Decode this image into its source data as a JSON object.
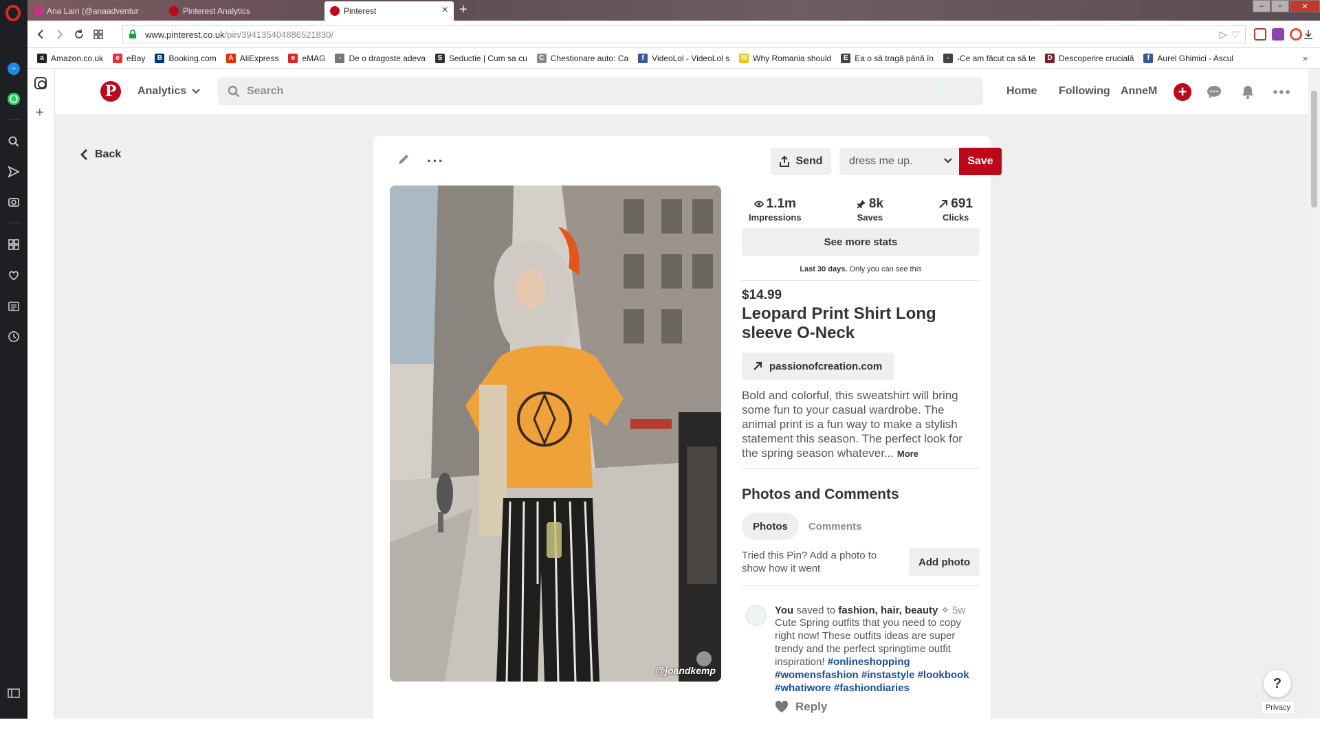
{
  "browser": {
    "tabs": [
      {
        "label": "Ana Lairi (@anaadventur",
        "color": "#c13584"
      },
      {
        "label": "Pinterest Analytics",
        "color": "#bd081c"
      },
      {
        "label": "Pinterest",
        "color": "#bd081c"
      }
    ],
    "url_host": "www.pinterest.co.uk",
    "url_path": "/pin/394135404886521830/",
    "bookmarks": [
      {
        "label": "Amazon.co.uk",
        "icon": "a",
        "color": "#222222"
      },
      {
        "label": "eBay",
        "icon": "e",
        "color": "#e53238"
      },
      {
        "label": "Booking.com",
        "icon": "B",
        "color": "#003580"
      },
      {
        "label": "AliExpress",
        "icon": "A",
        "color": "#e62e04"
      },
      {
        "label": "eMAG",
        "icon": "e",
        "color": "#d9232d"
      },
      {
        "label": "De o dragoste adeva",
        "icon": "-",
        "color": "#777777"
      },
      {
        "label": "Seductie | Cum sa cu",
        "icon": "S",
        "color": "#333333"
      },
      {
        "label": "Chestionare auto: Ca",
        "icon": "C",
        "color": "#888888"
      },
      {
        "label": "VideoLol - VideoLol s",
        "icon": "f",
        "color": "#3b5998"
      },
      {
        "label": "Why Romania should",
        "icon": "W",
        "color": "#f1c40f"
      },
      {
        "label": "Ea o să tragă până în",
        "icon": "E",
        "color": "#444444"
      },
      {
        "label": "-Ce am făcut ca să te",
        "icon": "-",
        "color": "#444444"
      },
      {
        "label": "Descoperire crucială",
        "icon": "D",
        "color": "#7b1f2e"
      },
      {
        "label": "Aurel Ghimici - Ascul",
        "icon": "f",
        "color": "#3b5998"
      }
    ]
  },
  "header": {
    "analytics_label": "Analytics",
    "search_placeholder": "Search",
    "home_label": "Home",
    "following_label": "Following",
    "username": "AnneM"
  },
  "back_label": "Back",
  "pin": {
    "send_label": "Send",
    "board_name": "dress me up.",
    "save_label": "Save",
    "image_credit": "@joandkemp",
    "stats": [
      {
        "value": "1.1m",
        "label": "Impressions",
        "icon": "eye-icon"
      },
      {
        "value": "8k",
        "label": "Saves",
        "icon": "pin-icon"
      },
      {
        "value": "691",
        "label": "Clicks",
        "icon": "arrow-icon"
      }
    ],
    "see_more_stats": "See more stats",
    "last_30_bold": "Last 30 days.",
    "last_30_rest": "Only you can see this",
    "price": "$14.99",
    "title": "Leopard Print Shirt Long sleeve O-Neck",
    "site": "passionofcreation.com",
    "description": "Bold and colorful, this sweatshirt will bring some fun to your casual wardrobe. The animal print is a fun way to make a stylish statement this season. The perfect look for the spring season whatever...",
    "more_label": "More",
    "section_title": "Photos and Comments",
    "tab_photos": "Photos",
    "tab_comments": "Comments",
    "tried_text": "Tried this Pin? Add a photo to show how it went",
    "add_photo": "Add photo",
    "comment": {
      "user": "You",
      "action": "saved to",
      "board": "fashion, hair, beauty",
      "time": "5w",
      "text": "Cute Spring outfits that you need to copy right now! These outfits ideas are super trendy and the perfect springtime outfit inspiration!",
      "tags": [
        "#onlineshopping",
        "#womensfashion",
        "#instastyle",
        "#lookbook",
        "#whatiwore",
        "#fashiondiaries"
      ],
      "reply_label": "Reply"
    }
  },
  "help_label": "?",
  "privacy_label": "Privacy"
}
